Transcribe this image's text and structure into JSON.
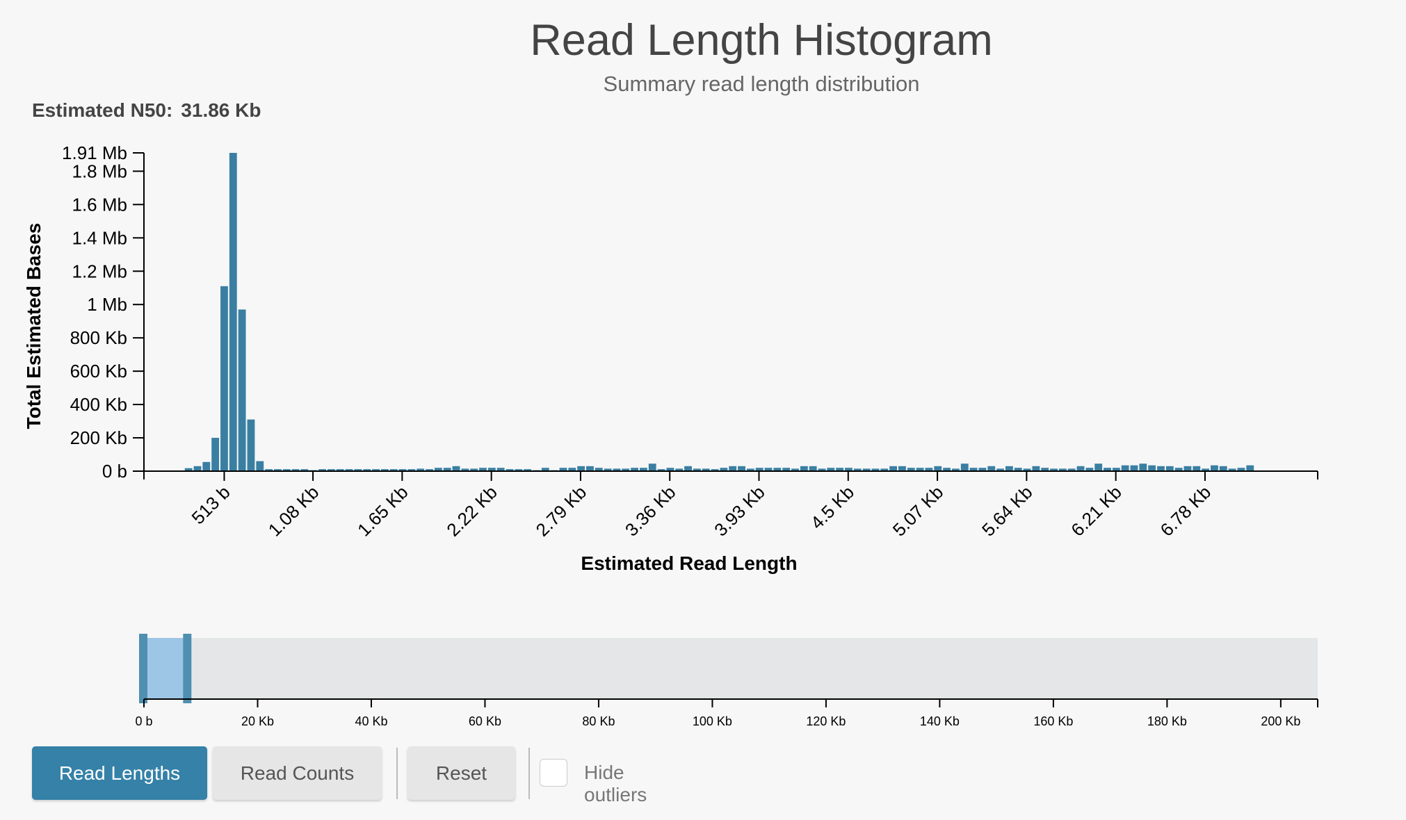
{
  "header": {
    "title": "Read Length Histogram",
    "subtitle": "Summary read length distribution"
  },
  "n50": {
    "label": "Estimated N50:",
    "value": "31.86 Kb"
  },
  "colors": {
    "bar": "#3a7fa2",
    "brush_selection": "#9dc6e6",
    "brush_handle": "#4f8fb0",
    "context_background": "#e5e6e8",
    "primary_button": "#3581a8"
  },
  "chart_data": [
    {
      "type": "bar",
      "ylabel": "Total Estimated Bases",
      "xlabel": "Estimated Read Length",
      "x_tick_labels": [
        "513 b",
        "1.08 Kb",
        "1.65 Kb",
        "2.22 Kb",
        "2.79 Kb",
        "3.36 Kb",
        "3.93 Kb",
        "4.5 Kb",
        "5.07 Kb",
        "5.64 Kb",
        "6.21 Kb",
        "6.78 Kb"
      ],
      "x_tick_values": [
        513,
        1080,
        1650,
        2220,
        2790,
        3360,
        3930,
        4500,
        5070,
        5640,
        6210,
        6780
      ],
      "xlim": [
        0,
        7500
      ],
      "y_ticks": [
        {
          "value": 0,
          "label": "0 b"
        },
        {
          "value": 200000,
          "label": "200 Kb"
        },
        {
          "value": 400000,
          "label": "400 Kb"
        },
        {
          "value": 600000,
          "label": "600 Kb"
        },
        {
          "value": 800000,
          "label": "800 Kb"
        },
        {
          "value": 1000000,
          "label": "1 Mb"
        },
        {
          "value": 1200000,
          "label": "1.2 Mb"
        },
        {
          "value": 1400000,
          "label": "1.4 Mb"
        },
        {
          "value": 1600000,
          "label": "1.6 Mb"
        },
        {
          "value": 1800000,
          "label": "1.8 Mb"
        },
        {
          "value": 1910000,
          "label": "1.91 Mb"
        }
      ],
      "ylim": [
        0,
        1910000
      ],
      "grid": false,
      "bin_width": 57,
      "x": [
        285,
        342,
        399,
        456,
        513,
        570,
        627,
        684,
        741,
        798,
        855,
        912,
        969,
        1026,
        1083,
        1140,
        1197,
        1254,
        1311,
        1368,
        1425,
        1482,
        1539,
        1596,
        1653,
        1710,
        1767,
        1824,
        1881,
        1938,
        1995,
        2052,
        2109,
        2166,
        2223,
        2280,
        2337,
        2394,
        2451,
        2508,
        2565,
        2622,
        2679,
        2736,
        2793,
        2850,
        2907,
        2964,
        3021,
        3078,
        3135,
        3192,
        3249,
        3306,
        3363,
        3420,
        3477,
        3534,
        3591,
        3648,
        3705,
        3762,
        3819,
        3876,
        3933,
        3990,
        4047,
        4104,
        4161,
        4218,
        4275,
        4332,
        4389,
        4446,
        4503,
        4560,
        4617,
        4674,
        4731,
        4788,
        4845,
        4902,
        4959,
        5016,
        5073,
        5130,
        5187,
        5244,
        5301,
        5358,
        5415,
        5472,
        5529,
        5586,
        5643,
        5700,
        5757,
        5814,
        5871,
        5928,
        5985,
        6042,
        6099,
        6156,
        6213,
        6270,
        6327,
        6384,
        6441,
        6498,
        6555,
        6612,
        6669,
        6726,
        6783,
        6840,
        6897,
        6954,
        7011,
        7068
      ],
      "values": [
        18000,
        30000,
        55000,
        200000,
        1110000,
        1910000,
        970000,
        310000,
        60000,
        12000,
        12000,
        12000,
        12000,
        12000,
        6000,
        12000,
        12000,
        12000,
        12000,
        12000,
        12000,
        12000,
        12000,
        12000,
        12000,
        12000,
        15000,
        12000,
        20000,
        20000,
        30000,
        15000,
        15000,
        20000,
        20000,
        20000,
        12000,
        12000,
        12000,
        6000,
        20000,
        6000,
        20000,
        20000,
        30000,
        30000,
        20000,
        15000,
        15000,
        15000,
        20000,
        20000,
        45000,
        12000,
        20000,
        15000,
        30000,
        15000,
        15000,
        12000,
        20000,
        30000,
        30000,
        15000,
        20000,
        20000,
        20000,
        20000,
        15000,
        30000,
        30000,
        15000,
        20000,
        20000,
        20000,
        15000,
        15000,
        15000,
        15000,
        30000,
        30000,
        20000,
        20000,
        20000,
        30000,
        20000,
        15000,
        45000,
        20000,
        20000,
        30000,
        15000,
        30000,
        20000,
        15000,
        30000,
        20000,
        15000,
        15000,
        15000,
        30000,
        20000,
        45000,
        20000,
        20000,
        35000,
        35000,
        45000,
        35000,
        30000,
        30000,
        20000,
        30000,
        30000,
        15000,
        35000,
        30000,
        15000,
        20000,
        35000
      ]
    },
    {
      "type": "bar",
      "role": "range selector",
      "x_tick_labels": [
        "0 b",
        "20 Kb",
        "40 Kb",
        "60 Kb",
        "80 Kb",
        "100 Kb",
        "120 Kb",
        "140 Kb",
        "160 Kb",
        "180 Kb",
        "200 Kb"
      ],
      "x_tick_values": [
        0,
        20000,
        40000,
        60000,
        80000,
        100000,
        120000,
        140000,
        160000,
        180000,
        200000
      ],
      "xlim": [
        0,
        206500
      ],
      "selection": [
        0,
        7500
      ]
    }
  ],
  "controls": {
    "read_lengths_label": "Read Lengths",
    "read_counts_label": "Read Counts",
    "reset_label": "Reset",
    "hide_outliers_label": "Hide outliers"
  }
}
